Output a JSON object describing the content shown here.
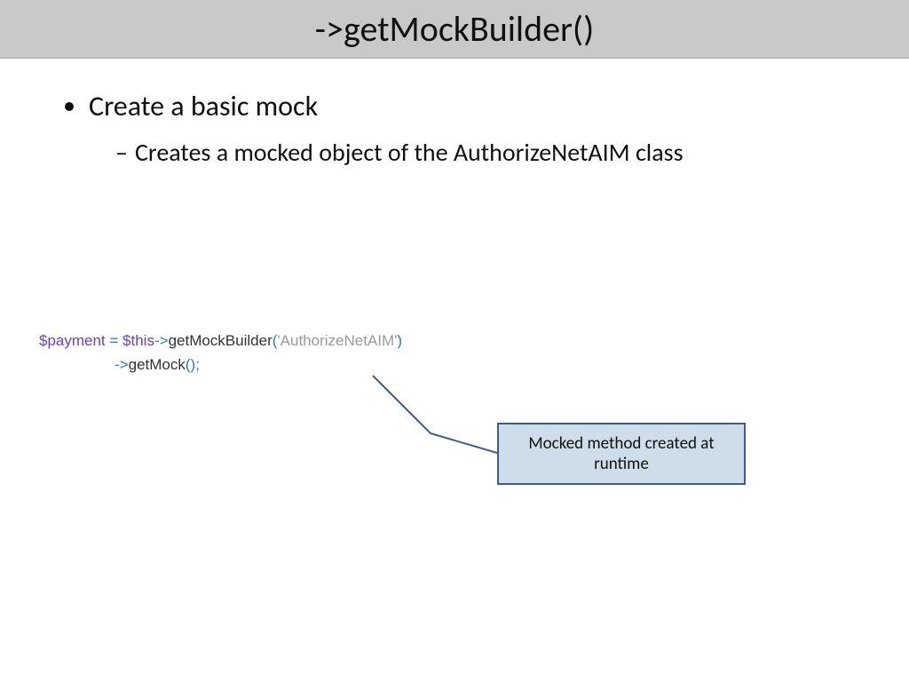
{
  "title": "->getMockBuilder()",
  "bullets": {
    "top": "Create a basic mock",
    "sub": "Creates a mocked object of the AuthorizeNetAIM class"
  },
  "code": {
    "var1": "$payment",
    "eq": " = ",
    "var2": "$this",
    "arrow1": "->",
    "call1": "getMockBuilder",
    "paren1_open": "(",
    "str1": "'AuthorizeNetAIM'",
    "paren1_close": ")",
    "indent": "                  ",
    "arrow2": "->",
    "call2": "getMock",
    "paren2": "();"
  },
  "callout": "Mocked method created at runtime"
}
